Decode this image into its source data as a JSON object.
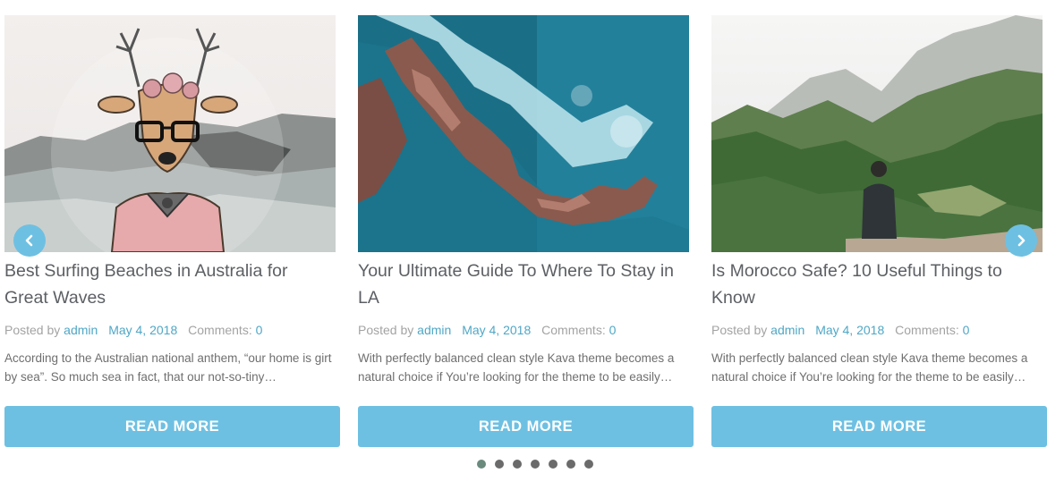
{
  "posts": [
    {
      "title": "Best Surfing Beaches in Australia for Great Waves",
      "posted_by_label": "Posted by",
      "author": "admin",
      "date": "May 4, 2018",
      "comments_label": "Comments:",
      "comments_count": "0",
      "excerpt": "According to the Australian national anthem, “our home is girt by sea”. So much sea in fact, that our not-so-tiny…",
      "read_more": "READ MORE"
    },
    {
      "title": "Your Ultimate Guide To Where To Stay in LA",
      "posted_by_label": "Posted by",
      "author": "admin",
      "date": "May 4, 2018",
      "comments_label": "Comments:",
      "comments_count": "0",
      "excerpt": "With perfectly balanced clean style Kava theme becomes a natural choice if You’re looking for the theme to be easily…",
      "read_more": "READ MORE"
    },
    {
      "title": "Is Morocco Safe? 10 Useful Things to Know",
      "posted_by_label": "Posted by",
      "author": "admin",
      "date": "May 4, 2018",
      "comments_label": "Comments:",
      "comments_count": "0",
      "excerpt": "With perfectly balanced clean style Kava theme becomes a natural choice if You’re looking for the theme to be easily…",
      "read_more": "READ MORE"
    }
  ],
  "navigation": {
    "prev_icon": "chevron-left-icon",
    "next_icon": "chevron-right-icon",
    "dot_count": 7,
    "active_dot": 1
  },
  "colors": {
    "accent": "#6ec0e2",
    "link": "#4fa7c6",
    "title": "#5c5f63",
    "meta": "#a3a3a3",
    "dot": "#6b6b6b",
    "dot_active": "#6a8a7e"
  }
}
